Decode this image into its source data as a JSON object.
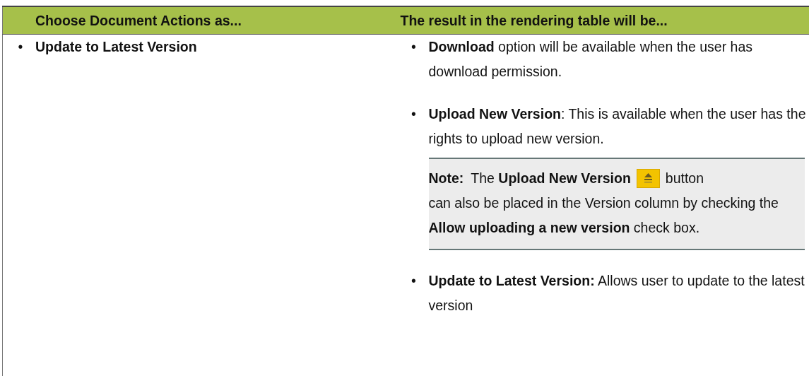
{
  "table": {
    "columns": [
      "Choose Document Actions as...",
      "The result in the rendering table will be..."
    ],
    "rows": [
      {
        "column_1": [
          {
            "bullet": "•",
            "text": "Update to Latest Version"
          }
        ],
        "column_2": [
          {
            "kind": "bullet",
            "bullet": "•",
            "text": "**Download** option will be available when the user has download permission."
          },
          {
            "kind": "bullet",
            "bullet": "•",
            "text": "**Upload New Version**: This is available when the user has the rights to upload new version."
          },
          {
            "kind": "note",
            "label": "Note:",
            "text_before": "The **Upload New Version**",
            "text_after": "button",
            "continuation": "can also be placed in the Version column by checking the **Allow uploading a new version** check box."
          },
          {
            "kind": "bullet",
            "bullet": "•",
            "text": "**Update to Latest Version:** Allows user to update to the latest version"
          }
        ]
      }
    ]
  }
}
